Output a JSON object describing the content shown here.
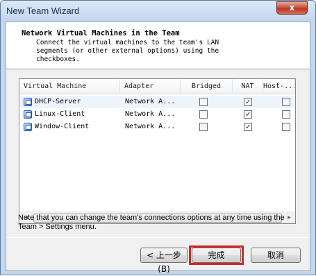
{
  "window": {
    "title": "New Team Wizard",
    "close_glyph": "x"
  },
  "header": {
    "title": "Network Virtual Machines in the Team",
    "description": "Connect the virtual machines to the team's LAN\nsegments (or other external options) using the\ncheckboxes."
  },
  "table": {
    "columns": [
      "Virtual Machine",
      "Adapter",
      "Bridged",
      "NAT",
      "Host-..."
    ],
    "rows": [
      {
        "name": "DHCP-Server",
        "adapter": "Network A...",
        "bridged": false,
        "nat": true,
        "host": false
      },
      {
        "name": "Linux-Client",
        "adapter": "Network A...",
        "bridged": false,
        "nat": true,
        "host": false
      },
      {
        "name": "Window-Client",
        "adapter": "Network A...",
        "bridged": false,
        "nat": true,
        "host": false
      }
    ],
    "scroll_left": "◂",
    "scroll_right": "▸",
    "scroll_grip": "III"
  },
  "note": "Note that you can change the team's connections options at any time using the Team > Settings menu.",
  "buttons": {
    "back": "< 上一步(B)",
    "finish": "完成",
    "cancel": "取消"
  },
  "colors": {
    "highlight": "#d32525",
    "selected_row": "#eef4fc"
  }
}
